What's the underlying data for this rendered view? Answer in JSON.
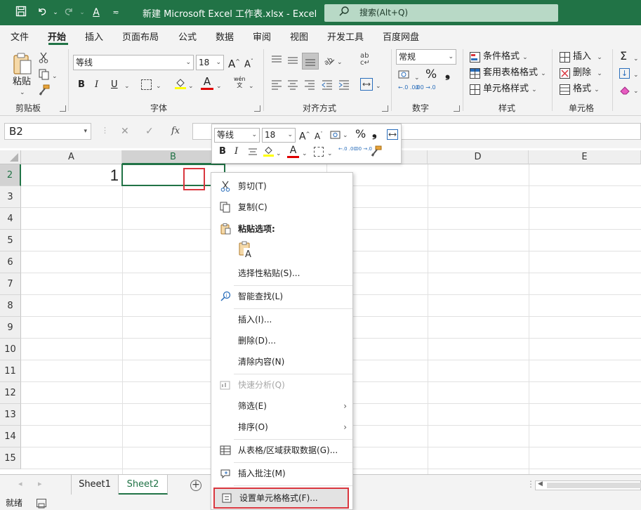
{
  "titlebar": {
    "title": "新建 Microsoft Excel 工作表.xlsx  -  Excel",
    "search_placeholder": "搜索(Alt+Q)",
    "save_icon": "save-icon",
    "undo_icon": "undo-icon",
    "redo_icon": "redo-icon"
  },
  "menu": {
    "tabs": [
      "文件",
      "开始",
      "插入",
      "页面布局",
      "公式",
      "数据",
      "审阅",
      "视图",
      "开发工具",
      "百度网盘"
    ],
    "active": "开始"
  },
  "ribbon": {
    "clipboard": {
      "paste": "粘贴",
      "label": "剪贴板"
    },
    "font": {
      "name": "等线",
      "size": "18",
      "grow": "A",
      "shrink": "A",
      "bold": "B",
      "italic": "I",
      "underline": "U",
      "phonetic": "wén",
      "label": "字体"
    },
    "alignment": {
      "label": "对齐方式"
    },
    "number": {
      "format": "常规",
      "percent": "%",
      "comma": "❟",
      "inc_decimal": "←.0 .00",
      "dec_decimal": ".00 →.0",
      "label": "数字"
    },
    "styles": {
      "conditional": "条件格式",
      "table": "套用表格格式",
      "cell": "单元格样式",
      "label": "样式"
    },
    "cells": {
      "insert": "插入",
      "delete": "删除",
      "format": "格式",
      "label": "单元格"
    },
    "editing": {
      "sum": "Σ"
    }
  },
  "formula_bar": {
    "name_box": "B2",
    "cancel": "✕",
    "enter": "✓",
    "fx": "fx",
    "content": ""
  },
  "grid": {
    "columns": [
      "A",
      "B",
      "",
      "D",
      "E"
    ],
    "rows": [
      "2",
      "3",
      "4",
      "5",
      "6",
      "7",
      "8",
      "9",
      "10",
      "11",
      "12",
      "13",
      "14",
      "15"
    ],
    "cells": {
      "A2": "1"
    },
    "active_cell": "B2"
  },
  "mini_toolbar": {
    "font": "等线",
    "size": "18",
    "grow": "A",
    "shrink": "A",
    "percent": "%",
    "comma": "❟",
    "bold": "B",
    "italic": "I",
    "font_color_letter": "A",
    "inc_decimal": "←.0 .00",
    "dec_decimal": ".00 →.0"
  },
  "context_menu": {
    "items": [
      {
        "label": "剪切(T)",
        "icon": "scissors-icon"
      },
      {
        "label": "复制(C)",
        "icon": "copy-icon"
      },
      {
        "label": "粘贴选项:",
        "icon": "paste-icon"
      },
      {
        "label": "",
        "icon": "paste-values-icon"
      },
      {
        "label": "选择性粘贴(S)...",
        "icon": ""
      },
      {
        "label": "智能查找(L)",
        "icon": "smart-lookup-icon"
      },
      {
        "label": "插入(I)...",
        "icon": ""
      },
      {
        "label": "删除(D)...",
        "icon": ""
      },
      {
        "label": "清除内容(N)",
        "icon": ""
      },
      {
        "label": "快速分析(Q)",
        "icon": "quick-analysis-icon"
      },
      {
        "label": "筛选(E)",
        "icon": ""
      },
      {
        "label": "排序(O)",
        "icon": ""
      },
      {
        "label": "从表格/区域获取数据(G)...",
        "icon": "table-icon"
      },
      {
        "label": "插入批注(M)",
        "icon": "comment-icon"
      },
      {
        "label": "设置单元格格式(F)...",
        "icon": "format-cells-icon"
      }
    ]
  },
  "sheets": {
    "tabs": [
      "Sheet1",
      "Sheet2"
    ],
    "active": "Sheet2",
    "add": "+"
  },
  "status": {
    "ready": "就绪"
  },
  "colors": {
    "excel_green": "#217346",
    "highlight_red": "#d9363e",
    "ribbon_bg": "#f3f3f3"
  }
}
